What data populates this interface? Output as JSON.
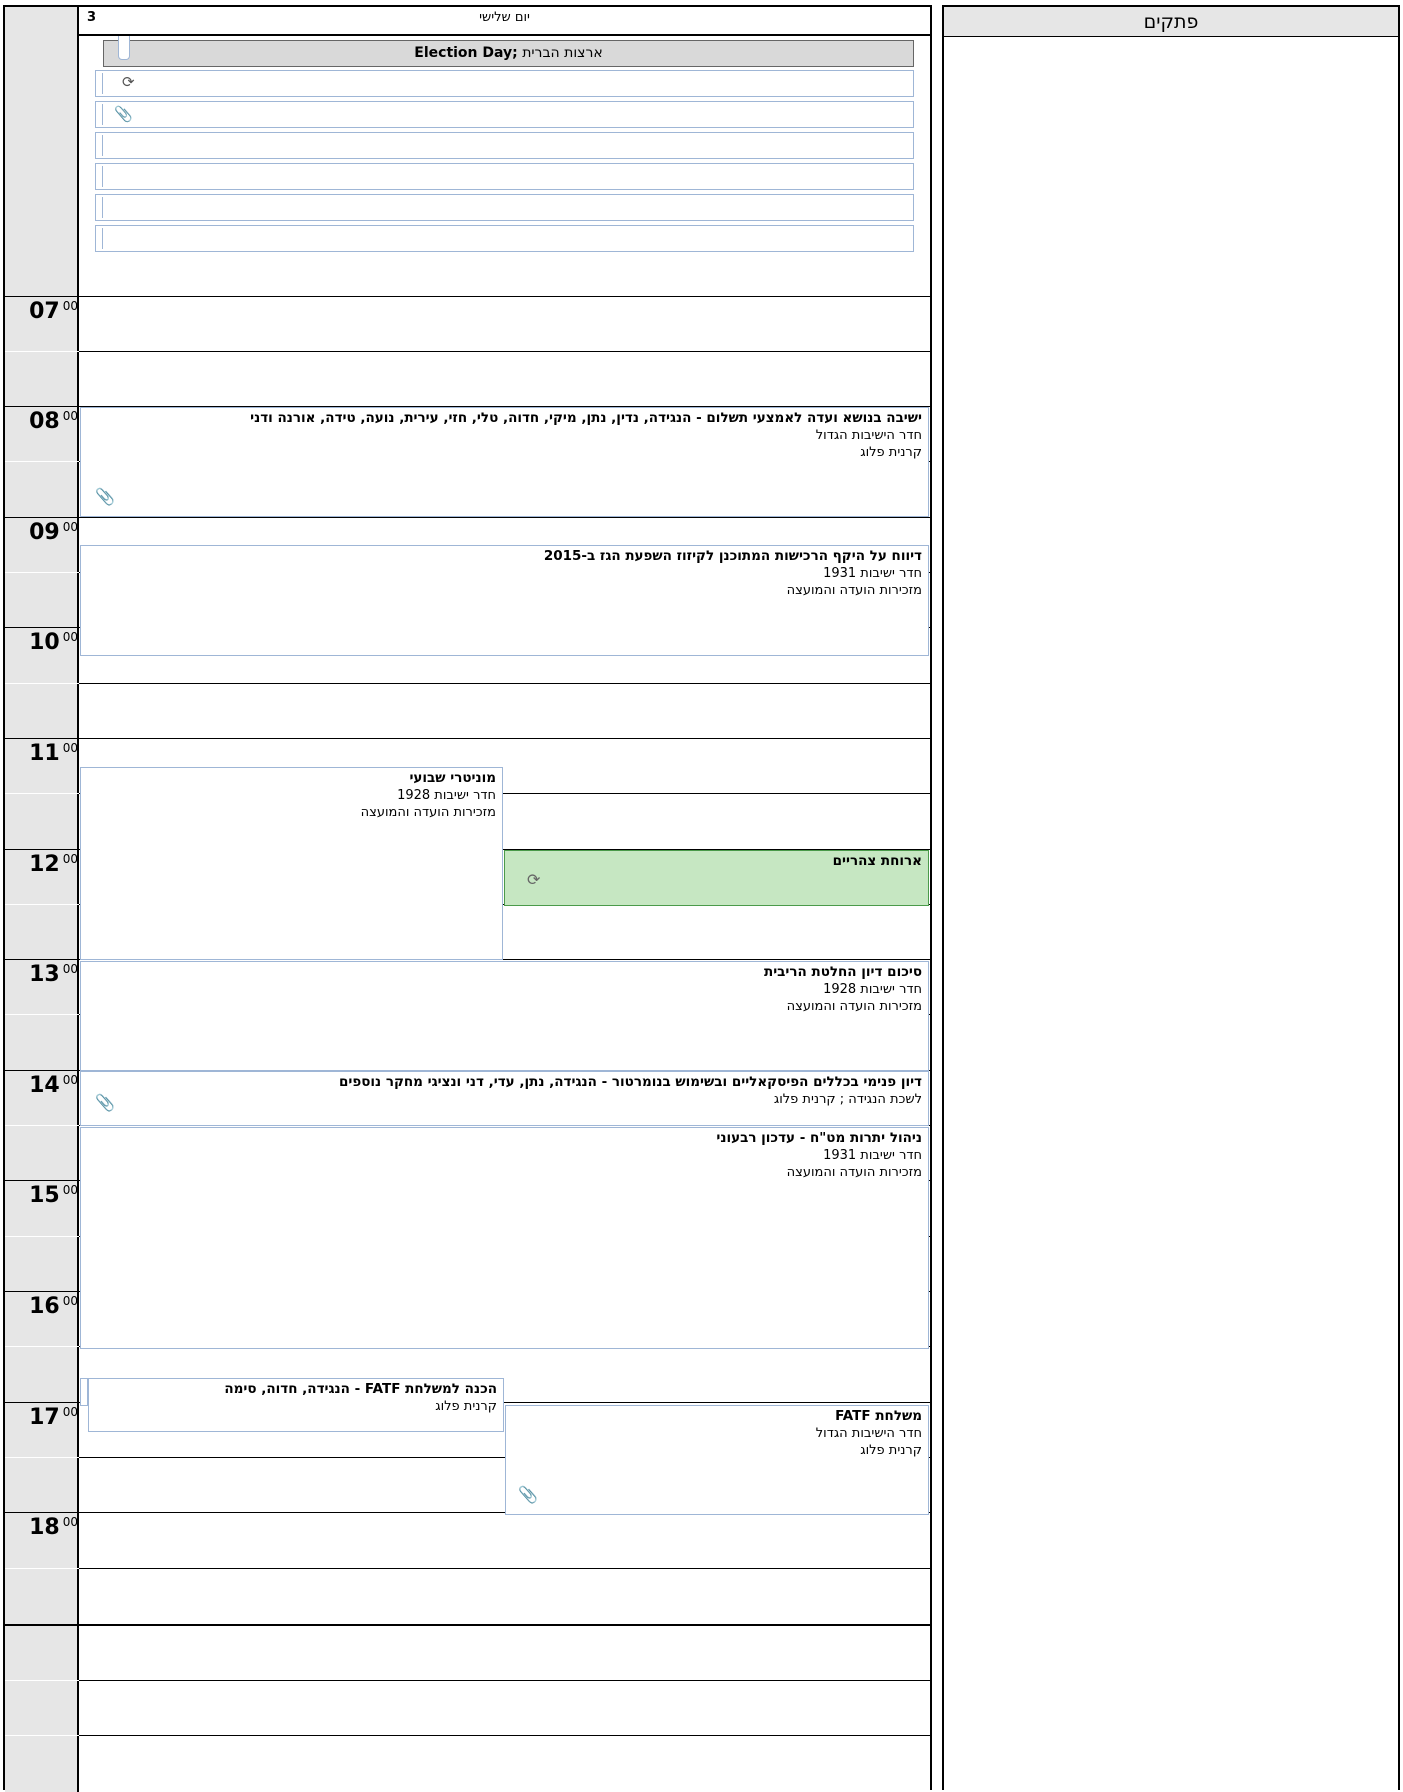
{
  "day": {
    "number": "3",
    "name": "יום שלישי"
  },
  "allday": {
    "event_title_en": "Election Day;",
    "event_title_he": " ארצות הברית"
  },
  "hours": [
    {
      "h": "07",
      "m": "00"
    },
    {
      "h": "08",
      "m": "00"
    },
    {
      "h": "09",
      "m": "00"
    },
    {
      "h": "10",
      "m": "00"
    },
    {
      "h": "11",
      "m": "00"
    },
    {
      "h": "12",
      "m": "00"
    },
    {
      "h": "13",
      "m": "00"
    },
    {
      "h": "14",
      "m": "00"
    },
    {
      "h": "15",
      "m": "00"
    },
    {
      "h": "16",
      "m": "00"
    },
    {
      "h": "17",
      "m": "00"
    },
    {
      "h": "18",
      "m": "00"
    }
  ],
  "events": {
    "payments": {
      "title": "ישיבה בנושא ועדה לאמצעי תשלום - הנגידה, נדין, נתן, מיקי, חדוה, טלי, חזי, עירית, נועה, טידה, אורנה ודני",
      "location": "חדר הישיבות הגדול",
      "organizer": "קרנית פלוג"
    },
    "gas": {
      "title": "דיווח על היקף הרכישות המתוכנן לקיזוז השפעת הגז ב-2015",
      "location": "חדר ישיבות 1931",
      "organizer": "מזכירות הועדה והמועצה"
    },
    "monitor": {
      "title": "מוניטרי שבועי",
      "location": "חדר ישיבות 1928",
      "organizer": "מזכירות הועדה והמועצה"
    },
    "lunch": {
      "title": "ארוחת צהריים"
    },
    "rate": {
      "title": "סיכום דיון החלטת הריבית",
      "location": "חדר ישיבות 1928",
      "organizer": "מזכירות הועדה והמועצה"
    },
    "fiscal": {
      "title": "דיון פנימי בכללים הפיסקאליים ובשימוש בנומרטור - הנגידה, נתן, עדי, דני ונציגי מחקר נוספים",
      "location": "לשכת הנגידה ; קרנית פלוג"
    },
    "fx": {
      "title": "ניהול יתרות מט\"ח - עדכון רבעוני",
      "location": "חדר ישיבות 1931",
      "organizer": "מזכירות הועדה והמועצה"
    },
    "fatf_prep": {
      "title": "הכנה למשלחת FATF - הנגידה, חדוה, סימה",
      "organizer": "קרנית פלוג"
    },
    "fatf": {
      "title": "משלחת FATF",
      "location": "חדר הישיבות הגדול",
      "organizer": "קרנית פלוג"
    }
  },
  "notes": {
    "title": "פתקים"
  },
  "icons": {
    "recurring": "recurring-icon",
    "attachment": "paperclip-icon"
  }
}
